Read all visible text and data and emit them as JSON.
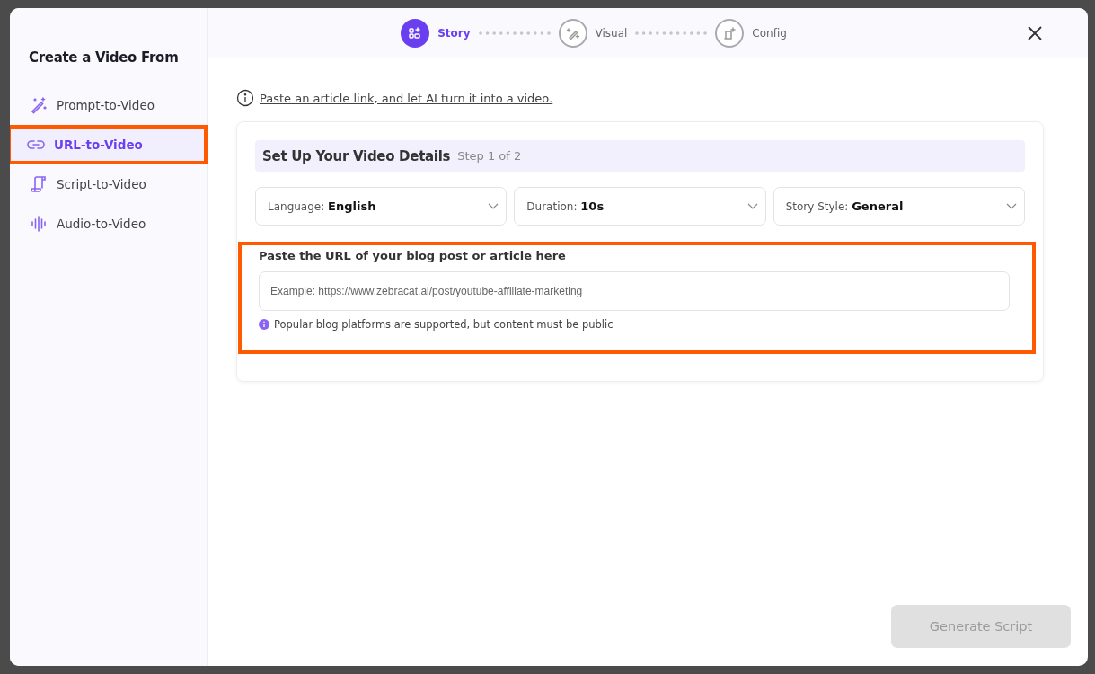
{
  "sidebar": {
    "title": "Create a Video From",
    "items": [
      {
        "label": "Prompt-to-Video",
        "kind": "wand",
        "selected": false,
        "highlighted": false
      },
      {
        "label": "URL-to-Video",
        "kind": "link",
        "selected": true,
        "highlighted": true
      },
      {
        "label": "Script-to-Video",
        "kind": "scroll",
        "selected": false,
        "highlighted": false
      },
      {
        "label": "Audio-to-Video",
        "kind": "audio",
        "selected": false,
        "highlighted": false
      }
    ]
  },
  "steps": [
    {
      "label": "Story",
      "kind": "story",
      "selected": true
    },
    {
      "label": "Visual",
      "kind": "visual",
      "selected": false
    },
    {
      "label": "Config",
      "kind": "config",
      "selected": false
    }
  ],
  "intro": "Paste an article link, and let AI turn it into a video.",
  "card": {
    "title": "Set Up Your Video Details",
    "step": "Step 1 of 2",
    "selects": [
      {
        "label": "Language:",
        "value": "English"
      },
      {
        "label": "Duration:",
        "value": "10s"
      },
      {
        "label": "Story Style:",
        "value": "General"
      }
    ],
    "url_section": {
      "highlighted": true,
      "heading": "Paste the URL of your blog post or article here",
      "placeholder": "Example: https://www.zebracat.ai/post/youtube-affiliate-marketing",
      "hint": "Popular blog platforms are supported, but content must be public"
    }
  },
  "button": {
    "label": "Generate Script",
    "disabled": true
  }
}
